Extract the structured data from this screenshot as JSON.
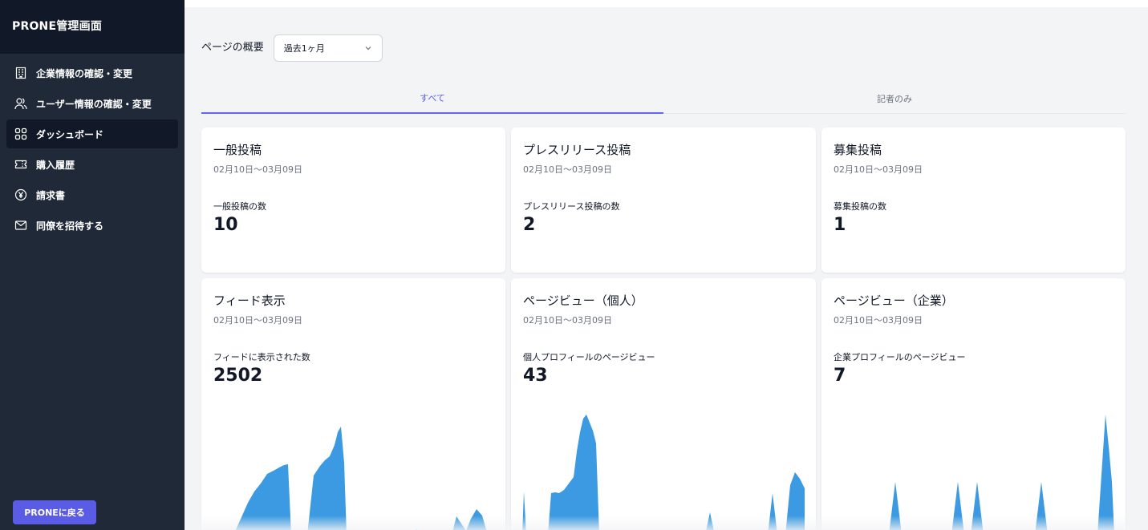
{
  "sidebar": {
    "title": "PRONE管理画面",
    "items": [
      {
        "label": "企業情報の確認・変更",
        "icon": "building-icon"
      },
      {
        "label": "ユーザー情報の確認・変更",
        "icon": "users-icon"
      },
      {
        "label": "ダッシュボード",
        "icon": "dashboard-grid-icon",
        "active": true
      },
      {
        "label": "購入履歴",
        "icon": "ticket-icon"
      },
      {
        "label": "請求書",
        "icon": "yen-circle-icon"
      },
      {
        "label": "同僚を招待する",
        "icon": "mail-icon"
      }
    ],
    "back_label": "PRONEに戻る"
  },
  "header": {
    "overview_label": "ページの概要",
    "period_value": "過去1ヶ月"
  },
  "tabs": [
    {
      "label": "すべて",
      "active": true
    },
    {
      "label": "記者のみ",
      "active": false
    }
  ],
  "cards": [
    {
      "title": "一般投稿",
      "date": "02月10日〜03月09日",
      "metric": "一般投稿の数",
      "value": "10"
    },
    {
      "title": "プレスリリース投稿",
      "date": "02月10日〜03月09日",
      "metric": "プレスリリース投稿の数",
      "value": "2"
    },
    {
      "title": "募集投稿",
      "date": "02月10日〜03月09日",
      "metric": "募集投稿の数",
      "value": "1"
    },
    {
      "title": "フィード表示",
      "date": "02月10日〜03月09日",
      "metric": "フィードに表示された数",
      "value": "2502"
    },
    {
      "title": "ページビュー（個人）",
      "date": "02月10日〜03月09日",
      "metric": "個人プロフィールのページビュー",
      "value": "43"
    },
    {
      "title": "ページビュー（企業）",
      "date": "02月10日〜03月09日",
      "metric": "企業プロフィールのページビュー",
      "value": "7"
    }
  ],
  "colors": {
    "sidebar_bg": "#1f2937",
    "sidebar_header_bg": "#111827",
    "accent": "#5b5ce6",
    "chart_fill": "#3b9ae1"
  }
}
